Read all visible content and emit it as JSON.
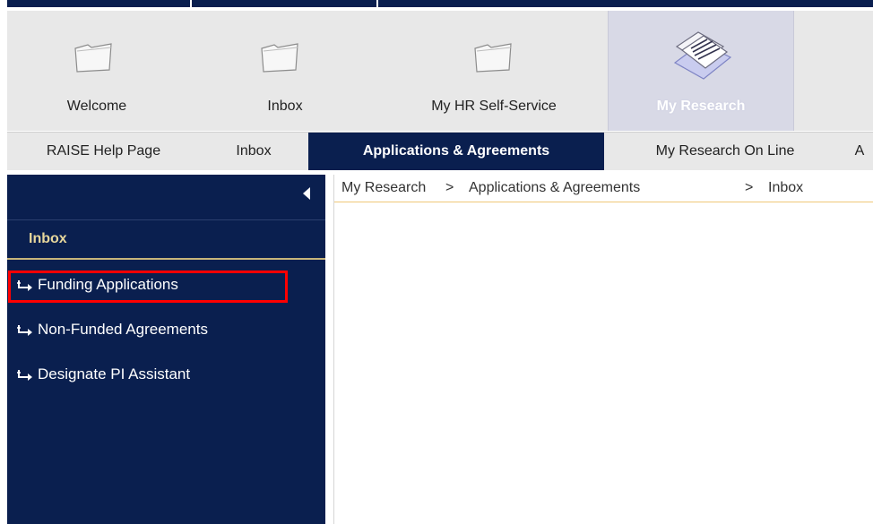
{
  "top_tabs": [
    {
      "label": "Welcome",
      "icon": "folder-icon",
      "active": false
    },
    {
      "label": "Inbox",
      "icon": "folder-icon",
      "active": false
    },
    {
      "label": "My HR Self-Service",
      "icon": "folder-icon",
      "active": false
    },
    {
      "label": "My Research",
      "icon": "documents-icon",
      "active": true
    }
  ],
  "menu": {
    "items": [
      "RAISE Help Page",
      "Inbox",
      "Applications & Agreements",
      "My Research On Line",
      "A"
    ],
    "active_index": 2
  },
  "sidebar": {
    "title": "Inbox",
    "items": [
      "Funding Applications",
      "Non-Funded Agreements",
      "Designate PI Assistant"
    ]
  },
  "breadcrumb": {
    "parts": [
      "My Research",
      "Applications & Agreements",
      "Inbox"
    ],
    "separator": ">"
  },
  "colors": {
    "navy": "#0a1f4f",
    "gold": "#e7d79c",
    "highlight": "#ff0000"
  }
}
